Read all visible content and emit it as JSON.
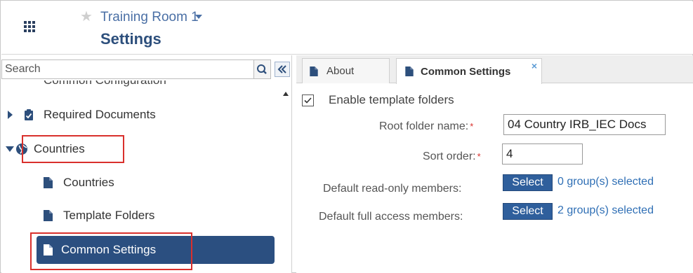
{
  "header": {
    "room_name": "Training Room 1",
    "page_title": "Settings"
  },
  "left": {
    "search": {
      "placeholder": "Search",
      "value": ""
    },
    "tree_partial_label": "Common Configuration",
    "tree": {
      "required_documents": "Required Documents",
      "countries": "Countries",
      "countries_child": "Countries",
      "template_folders": "Template Folders",
      "common_settings": "Common Settings"
    }
  },
  "tabs": [
    {
      "label": "About"
    },
    {
      "label": "Common Settings",
      "close": "×"
    }
  ],
  "form": {
    "enable_template_folders": {
      "label": "Enable template folders",
      "checked": true
    },
    "root_folder_name": {
      "label": "Root folder name:",
      "required": "*",
      "value": "04 Country IRB_IEC Docs"
    },
    "sort_order": {
      "label": "Sort order:",
      "required": "*",
      "value": "4"
    },
    "read_only_members": {
      "label": "Default read-only members:",
      "button": "Select",
      "link": "0 group(s) selected"
    },
    "full_access_members": {
      "label": "Default full access members:",
      "button": "Select",
      "link": "2 group(s) selected"
    }
  },
  "colors": {
    "brand_navy": "#2d4f7c",
    "selected_row": "#2b4f80",
    "select_button": "#2f5f9c",
    "link_blue": "#2f6fb5",
    "highlight_red": "#d9302c"
  },
  "icons": {
    "app_launcher": "grid-icon",
    "favorite": "star-icon",
    "search": "search-icon",
    "collapse": "double-chevron-left-icon",
    "document": "document-icon",
    "clipboard": "clipboard-check-icon",
    "globe": "globe-icon"
  }
}
